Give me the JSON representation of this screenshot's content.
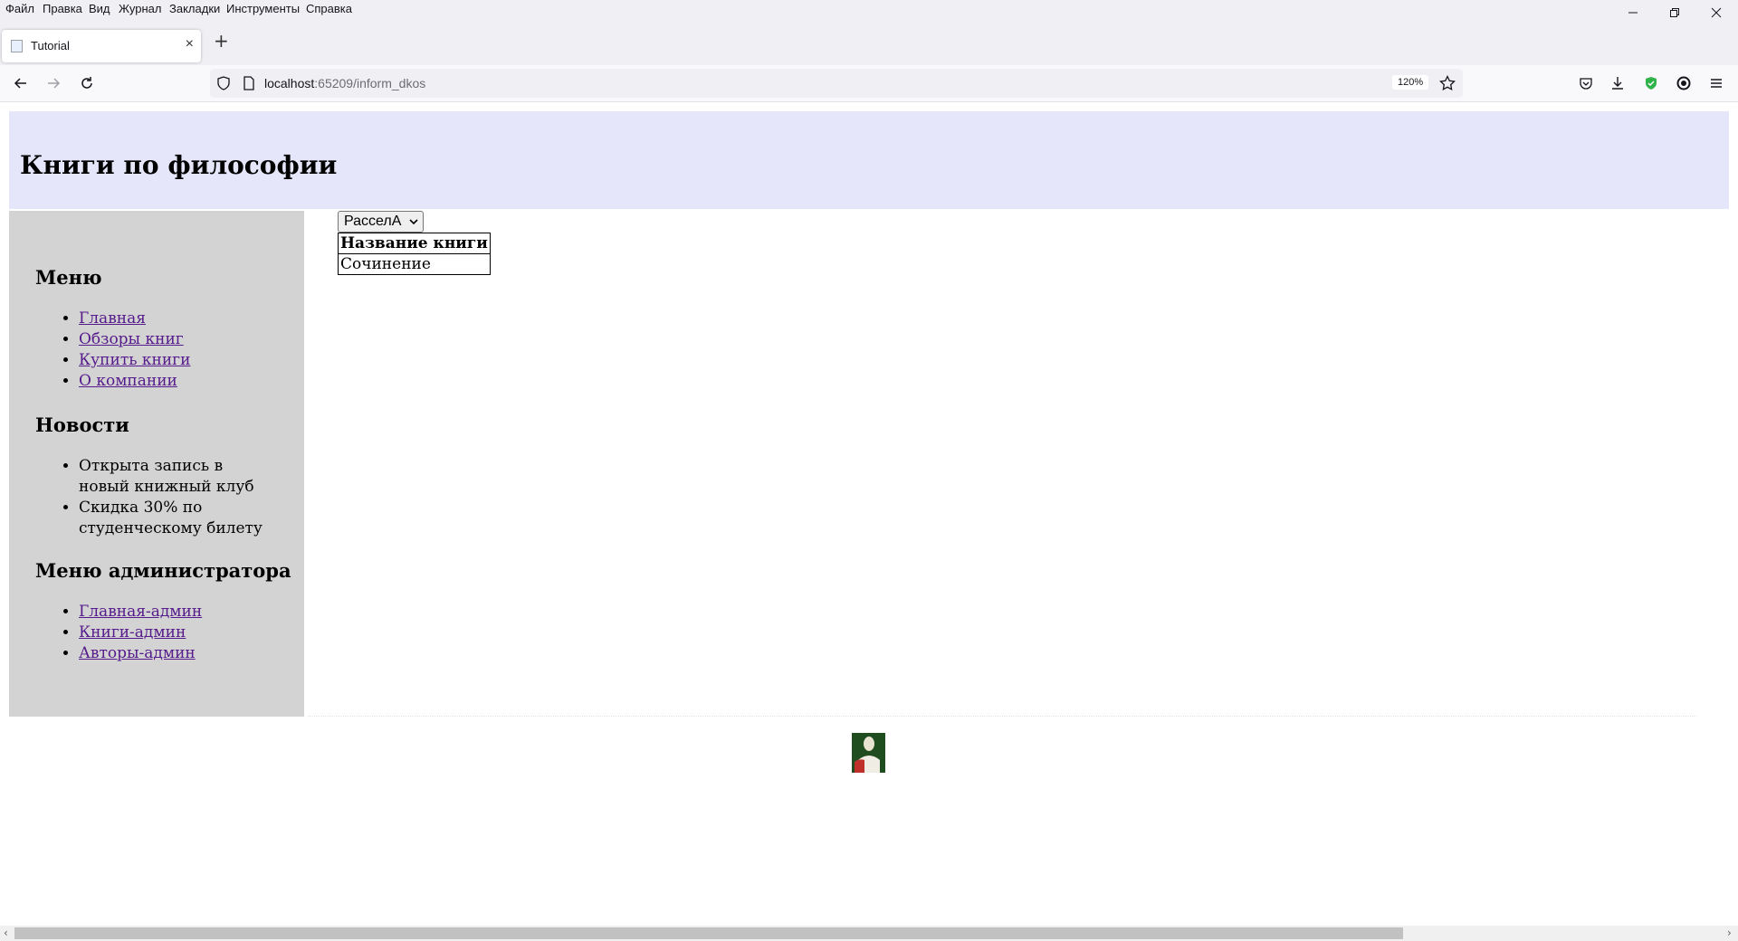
{
  "browser": {
    "menu": [
      "Файл",
      "Правка",
      "Вид",
      "Журнал",
      "Закладки",
      "Инструменты",
      "Справка"
    ],
    "tab_title": "Tutorial",
    "url_host": "localhost",
    "url_rest": ":65209/inform_dkos",
    "zoom": "120%"
  },
  "page": {
    "title": "Книги по философии",
    "sidebar": {
      "menu_heading": "Меню",
      "menu_items": [
        "Главная",
        "Обзоры книг",
        "Купить книги",
        "О компании"
      ],
      "news_heading": "Новости",
      "news_items": [
        "Открыта запись в новый книжный клуб",
        "Скидка 30% по студенческому билету"
      ],
      "admin_heading": "Меню администратора",
      "admin_items": [
        "Главная-админ",
        "Книги-админ",
        "Авторы-админ"
      ]
    },
    "author_select": {
      "value": "РасселА"
    },
    "table": {
      "header": "Название книги",
      "rows": [
        "Сочинение"
      ]
    }
  },
  "colors": {
    "header_bg": "#e6e6fa",
    "sidebar_bg": "#d3d3d3",
    "link": "#551a8b"
  }
}
